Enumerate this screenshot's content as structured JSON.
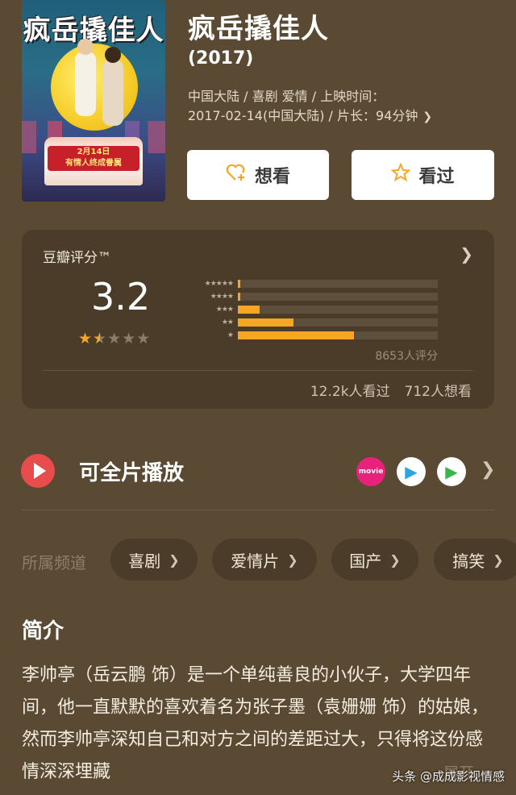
{
  "poster": {
    "title_art": "疯岳撬佳人",
    "date_text": "2月14日",
    "tagline": "有情人终成眷属"
  },
  "movie": {
    "title": "疯岳撬佳人",
    "year": "(2017)",
    "meta_line1": "中国大陆 / 喜剧 爱情 / 上映时间：",
    "meta_line2": "2017-02-14(中国大陆) / 片长：94分钟"
  },
  "actions": {
    "want_label": "想看",
    "seen_label": "看过"
  },
  "rating": {
    "label": "豆瓣评分™",
    "score": "3.2",
    "star_value": 1.5,
    "distribution": [
      {
        "stars": 5,
        "fraction": 0.012
      },
      {
        "stars": 4,
        "fraction": 0.012
      },
      {
        "stars": 3,
        "fraction": 0.11
      },
      {
        "stars": 2,
        "fraction": 0.28
      },
      {
        "stars": 1,
        "fraction": 0.58
      }
    ],
    "count": "8653人评分",
    "watched": "12.2k人看过",
    "wanted": "712人想看"
  },
  "play": {
    "label": "可全片播放",
    "platforms": [
      "movie",
      "youku-icon",
      "tencent-video-icon"
    ],
    "platform1_text": "movie"
  },
  "channels": {
    "label": "所属频道",
    "items": [
      "喜剧",
      "爱情片",
      "国产",
      "搞笑"
    ]
  },
  "synopsis": {
    "title": "简介",
    "text": "李帅亭（岳云鹏 饰）是一个单纯善良的小伙子，大学四年间，他一直默默的喜欢着名为张子墨（袁姗姗 饰）的姑娘，然而李帅亭深知自己和对方之间的差距过大，只得将这份感情深深埋藏",
    "more": "展开"
  },
  "watermark": "头条 @成成影视情感",
  "colors": {
    "background": "#5a4a33",
    "card": "#4a3c29",
    "accent": "#f5a623",
    "play": "#e94c4c"
  }
}
